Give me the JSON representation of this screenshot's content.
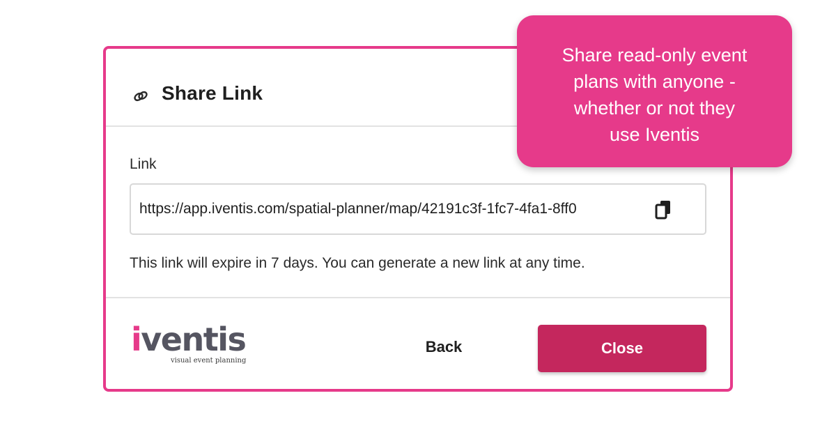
{
  "dialog": {
    "title": "Share Link",
    "title_icon": "link-icon",
    "link_label": "Link",
    "link_value": "https://app.iventis.com/spatial-planner/map/42191c3f-1fc7-4fa1-8ff0",
    "copy_icon": "copy-icon",
    "expiry_text": "This link will expire in 7 days. You can generate a new link at any time.",
    "back_label": "Back",
    "close_label": "Close"
  },
  "logo": {
    "accent_letter": "i",
    "rest_letters": "ventis",
    "tagline": "visual event planning"
  },
  "callout": {
    "text": "Share read-only event\nplans with anyone -\nwhether or not they\nuse Iventis"
  },
  "colors": {
    "brand_pink": "#e63a8a",
    "button_pink": "#c4275d",
    "logo_gray": "#555561"
  }
}
